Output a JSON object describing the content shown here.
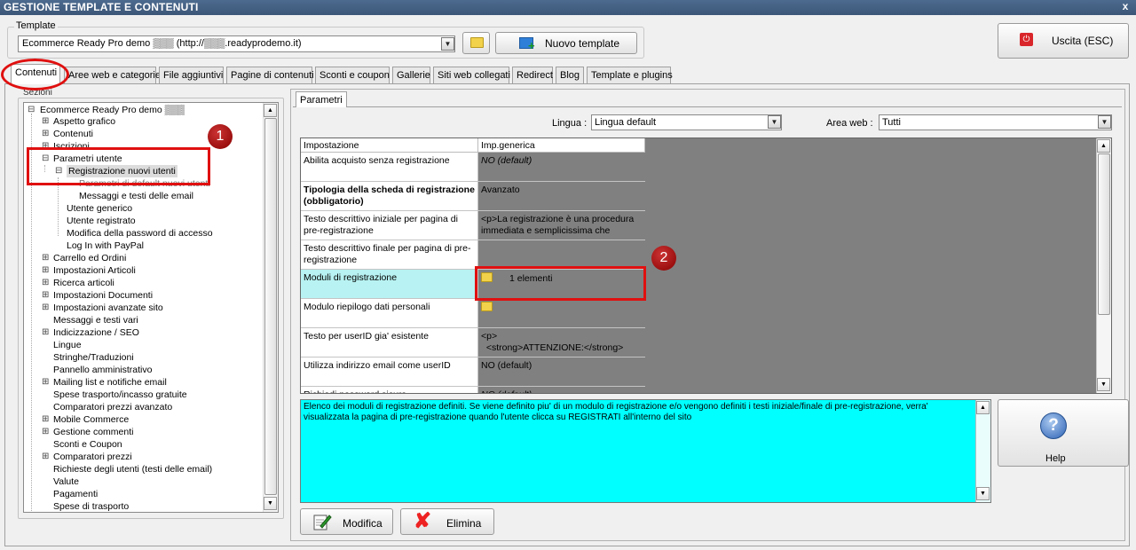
{
  "window": {
    "title": "GESTIONE TEMPLATE E CONTENUTI",
    "close_glyph": "x"
  },
  "template": {
    "legend": "Template",
    "selected": "Ecommerce Ready Pro demo ▒▒▒ (http://▒▒▒.readyprodemo.it)",
    "new_label": "Nuovo template",
    "exit_label": "Uscita (ESC)"
  },
  "tabs": [
    "Contenuti",
    "Aree web e categorie",
    "File aggiuntivi",
    "Pagine di contenuti",
    "Sconti e coupon",
    "Gallerie",
    "Siti web collegati",
    "Redirect",
    "Blog",
    "Template e plugins"
  ],
  "sections": {
    "legend": "Sezioni",
    "root": "Ecommerce Ready Pro demo ▒▒▒",
    "items": [
      "Aspetto grafico",
      "Contenuti",
      "Iscrizioni",
      "Parametri utente",
      "Registrazione nuovi utenti",
      "Parametri di default nuovi utenti",
      "Messaggi e testi delle email",
      "Utente generico",
      "Utente registrato",
      "Modifica della password di accesso",
      "Log In with PayPal",
      "Carrello ed Ordini",
      "Impostazioni Articoli",
      "Ricerca articoli",
      "Impostazioni Documenti",
      "Impostazioni avanzate sito",
      "Messaggi e testi vari",
      "Indicizzazione / SEO",
      "Lingue",
      "Stringhe/Traduzioni",
      "Pannello amministrativo",
      "Mailing list e notifiche email",
      "Spese trasporto/incasso gratuite",
      "Comparatori prezzi avanzato",
      "Mobile Commerce",
      "Gestione commenti",
      "Sconti e Coupon",
      "Comparatori prezzi",
      "Richieste degli utenti (testi delle email)",
      "Valute",
      "Pagamenti",
      "Spese di trasporto"
    ]
  },
  "params": {
    "tab_label": "Parametri",
    "lingua_label": "Lingua :",
    "lingua_value": "Lingua default",
    "area_label": "Area web :",
    "area_value": "Tutti",
    "headers": [
      "Impostazione",
      "Imp.generica"
    ],
    "rows": [
      {
        "name": "Abilita acquisto senza registrazione",
        "value": "NO (default)"
      },
      {
        "name": "Tipologia della scheda di registrazione (obbligatorio)",
        "value": "Avanzato"
      },
      {
        "name": "Testo descrittivo iniziale per pagina di pre-registrazione",
        "value": "<p>La registrazione è una procedura immediata e semplicissima che"
      },
      {
        "name": "Testo descrittivo finale per pagina di pre-registrazione",
        "value": ""
      },
      {
        "name": "Moduli di registrazione",
        "value": "1 elementi"
      },
      {
        "name": "Modulo riepilogo dati personali",
        "value": ""
      },
      {
        "name": "Testo per userID gia' esistente",
        "value": "<p>\n  <strong>ATTENZIONE:</strong>"
      },
      {
        "name": "Utilizza indirizzo email come userID",
        "value": "NO (default)"
      },
      {
        "name": "Richiedi password sicura",
        "value": "NO (default)"
      }
    ],
    "description": "Elenco dei moduli di registrazione definiti. Se viene definito piu' di un modulo di registrazione e/o vengono definiti i testi iniziale/finale di pre-registrazione, verra' visualizzata la pagina di pre-registrazione quando l'utente clicca su REGISTRATI all'interno del sito",
    "help_label": "Help",
    "modify_label": "Modifica",
    "delete_label": "Elimina"
  },
  "annotations": {
    "badge1": "1",
    "badge2": "2"
  },
  "colors": {
    "highlight": "#00ffff",
    "annotation": "#e01010",
    "titlebar": "#3b5677"
  }
}
